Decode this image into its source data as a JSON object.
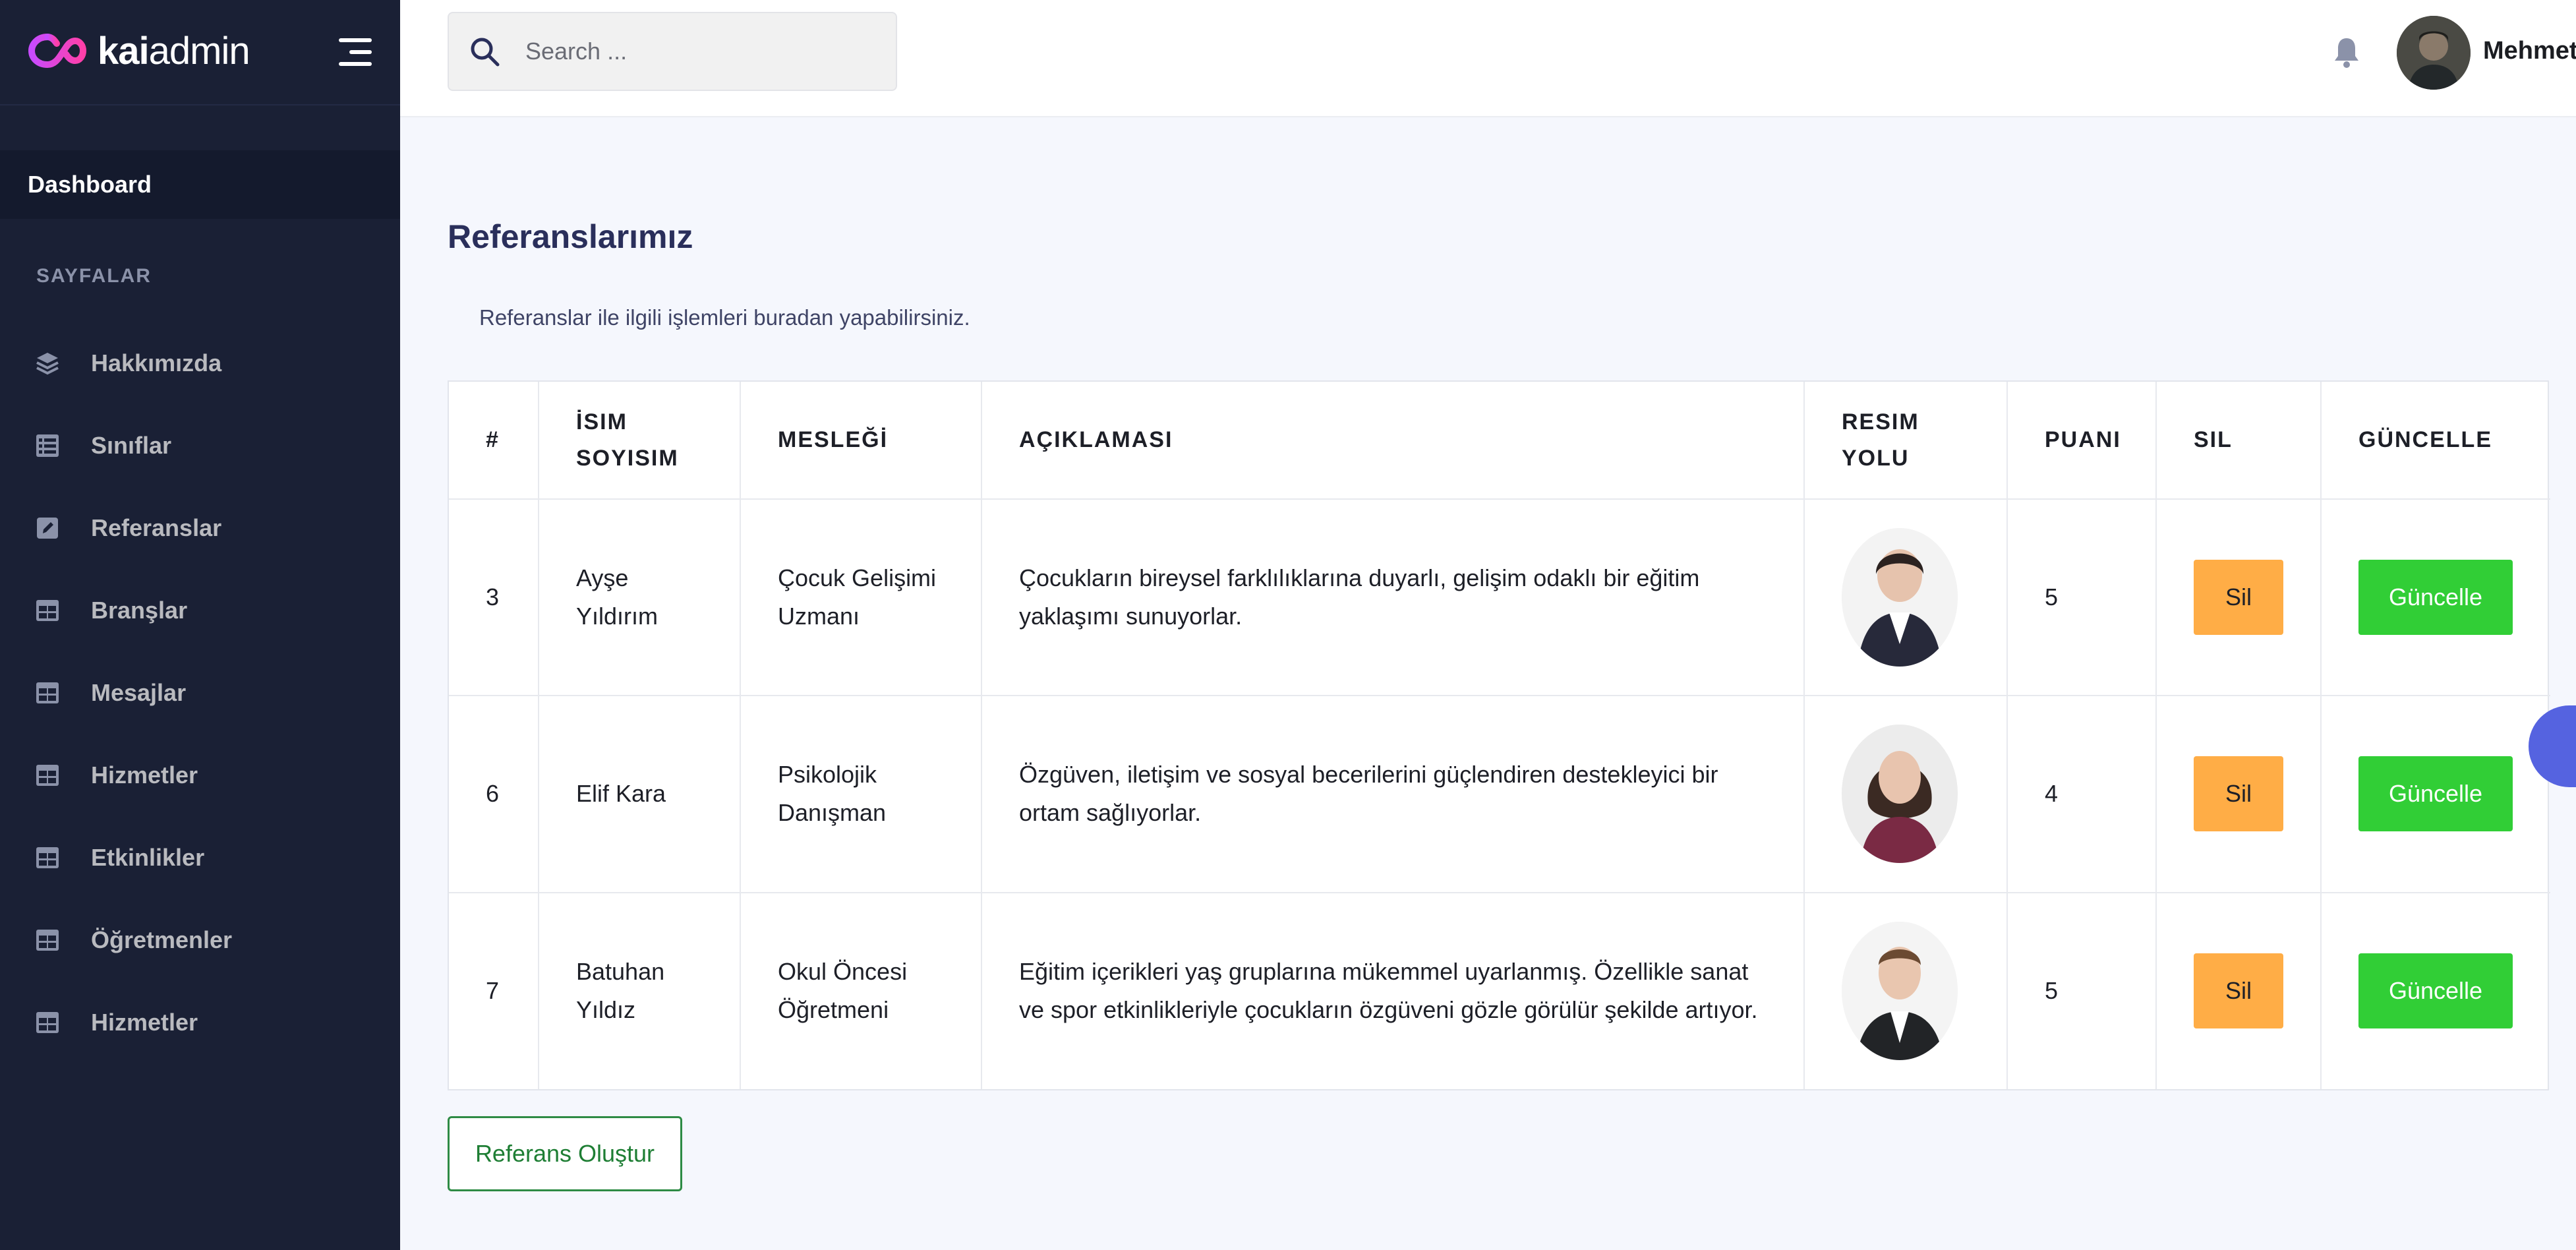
{
  "brand": {
    "name_bold": "kai",
    "name_light": "admin"
  },
  "sidebar": {
    "dashboard": "Dashboard",
    "section": "SAYFALAR",
    "items": [
      {
        "label": "Hakkımızda",
        "icon": "layers-icon"
      },
      {
        "label": "Sınıflar",
        "icon": "table-list-icon"
      },
      {
        "label": "Referanslar",
        "icon": "pen-square-icon"
      },
      {
        "label": "Branşlar",
        "icon": "table-icon"
      },
      {
        "label": "Mesajlar",
        "icon": "table-icon"
      },
      {
        "label": "Hizmetler",
        "icon": "table-icon"
      },
      {
        "label": "Etkinlikler",
        "icon": "table-icon"
      },
      {
        "label": "Öğretmenler",
        "icon": "table-icon"
      },
      {
        "label": "Hizmetler",
        "icon": "table-icon"
      }
    ]
  },
  "header": {
    "search_placeholder": "Search ...",
    "user_name": "Mehmet"
  },
  "page": {
    "title": "Referanslarımız",
    "description": "Referanslar ile ilgili işlemleri buradan yapabilirsiniz."
  },
  "table": {
    "columns": [
      "#",
      "İSIM SOYISIM",
      "MESLEĞİ",
      "AÇIKLAMASI",
      "RESIM YOLU",
      "PUANI",
      "SIL",
      "GÜNCELLE"
    ],
    "rows": [
      {
        "id": "3",
        "name": "Ayşe Yıldırım",
        "job": "Çocuk Gelişimi Uzmanı",
        "desc": "Çocukların bireysel farklılıklarına duyarlı, gelişim odaklı bir eğitim yaklaşımı sunuyorlar.",
        "score": "5",
        "delete": "Sil",
        "update": "Güncelle"
      },
      {
        "id": "6",
        "name": "Elif Kara",
        "job": "Psikolojik Danışman",
        "desc": "Özgüven, iletişim ve sosyal becerilerini güçlendiren destekleyici bir ortam sağlıyorlar.",
        "score": "4",
        "delete": "Sil",
        "update": "Güncelle"
      },
      {
        "id": "7",
        "name": "Batuhan Yıldız",
        "job": "Okul Öncesi Öğretmeni",
        "desc": "Eğitim içerikleri yaş gruplarına mükemmel uyarlanmış. Özellikle sanat ve spor etkinlikleriyle çocukların özgüveni gözle görülür şekilde artıyor.",
        "score": "5",
        "delete": "Sil",
        "update": "Güncelle"
      }
    ]
  },
  "actions": {
    "create_label": "Referans Oluştur"
  },
  "colors": {
    "sidebar_bg": "#1a2035",
    "sidebar_active": "#141a2d",
    "page_bg": "#f5f7fd",
    "delete_btn": "#ffad46",
    "update_btn": "#31ce36",
    "create_btn_border": "#2e8b45",
    "float_btn": "#5563e0"
  }
}
